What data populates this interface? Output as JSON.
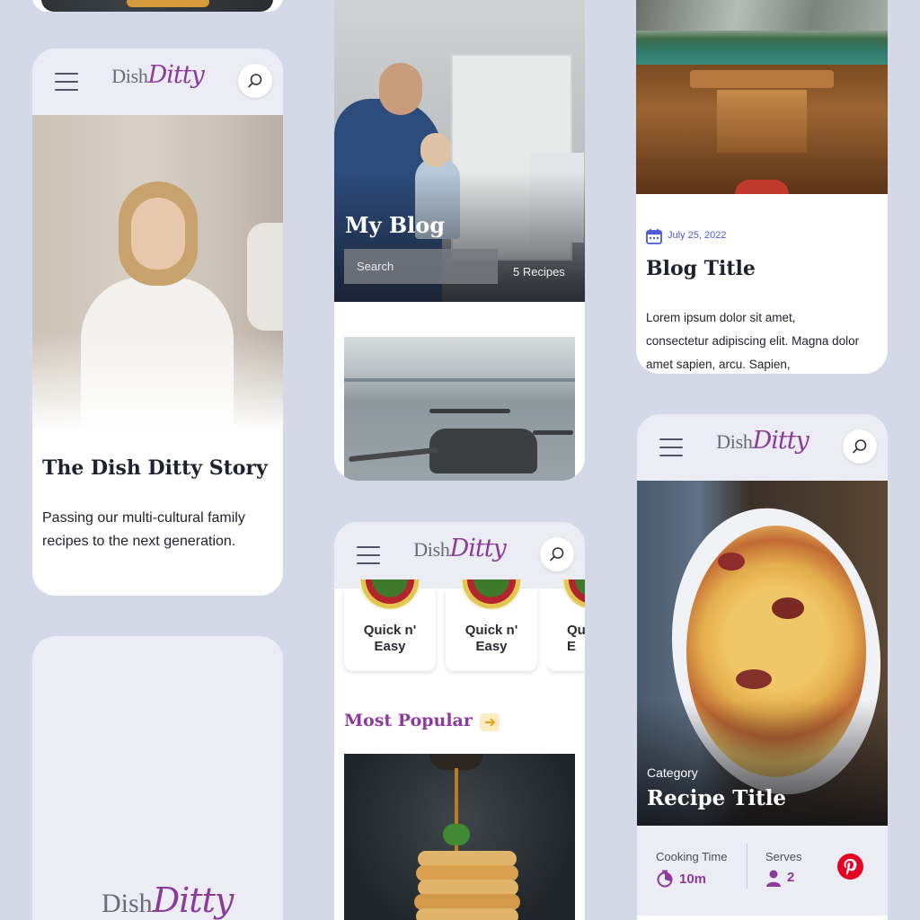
{
  "brand": {
    "logo_dish": "Dish",
    "logo_ditty": "Ditty"
  },
  "about_card": {
    "title": "The Dish Ditty Story",
    "description": "Passing our multi-cultural family recipes to the next generation."
  },
  "blog_card": {
    "title": "My Blog",
    "search_placeholder": "Search",
    "count_text": "5 Recipes"
  },
  "blog_post_card": {
    "date": "July 25, 2022",
    "title": "Blog Title",
    "excerpt": "Lorem ipsum dolor sit amet, consectetur adipiscing elit. Magna dolor amet sapien, arcu. Sapien,"
  },
  "home_card": {
    "categories": [
      {
        "label": "Quick n'\nEasy"
      },
      {
        "label": "Quick n'\nEasy"
      },
      {
        "label": "Qu\nE"
      }
    ],
    "section_title": "Most Popular"
  },
  "recipe_card": {
    "category": "Category",
    "title": "Recipe Title",
    "cooking_time_label": "Cooking Time",
    "cooking_time_value": "10m",
    "serves_label": "Serves",
    "serves_value": "2"
  },
  "colors": {
    "accent": "#8c3a9c",
    "background": "#d4d8e7",
    "date_blue": "#4a5bd6",
    "pinterest": "#e60023",
    "arrow_badge": "#fdebc4"
  },
  "icons": [
    "menu-icon",
    "search-icon",
    "calendar-icon",
    "arrow-right-icon",
    "timer-icon",
    "person-icon",
    "pinterest-icon"
  ]
}
